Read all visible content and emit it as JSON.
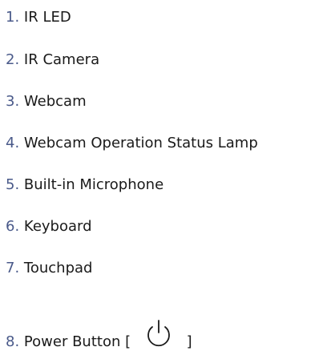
{
  "items": [
    {
      "num": "1.",
      "label": "IR LED"
    },
    {
      "num": "2.",
      "label": "IR Camera"
    },
    {
      "num": "3.",
      "label": "Webcam"
    },
    {
      "num": "4.",
      "label": "Webcam Operation Status Lamp"
    },
    {
      "num": "5.",
      "label": "Built-in Microphone"
    },
    {
      "num": "6.",
      "label": "Keyboard"
    },
    {
      "num": "7.",
      "label": "Touchpad"
    },
    {
      "num": "8.",
      "label": "Power Button [",
      "suffix": "]",
      "icon": "power-icon"
    }
  ]
}
